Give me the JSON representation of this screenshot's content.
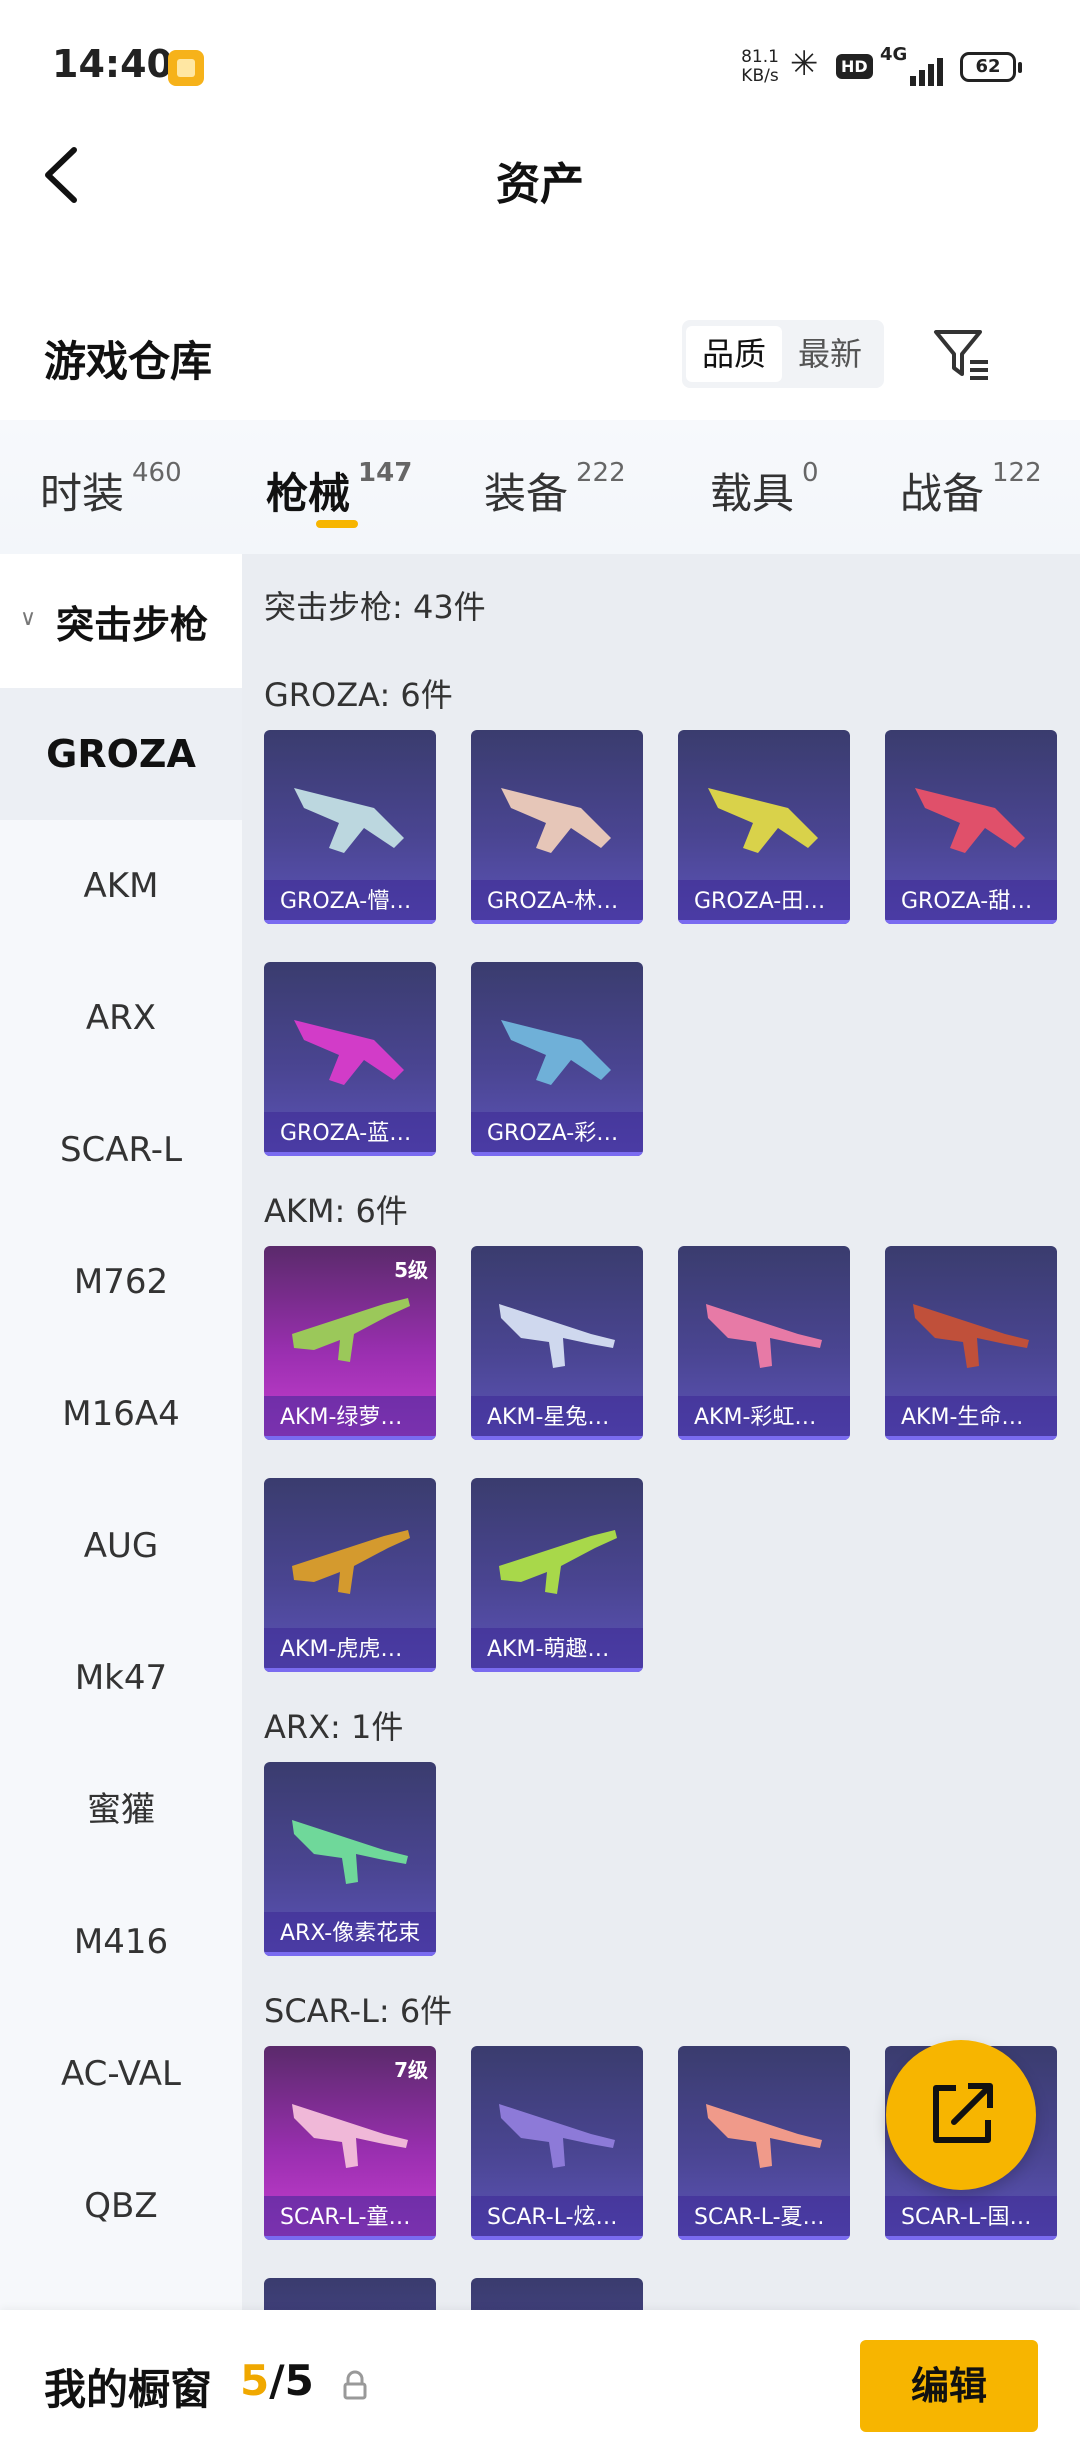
{
  "status_bar": {
    "time": "14:40",
    "net_speed_value": "81.1",
    "net_speed_unit": "KB/s",
    "hd": "HD",
    "network": "4G",
    "battery": "62"
  },
  "header": {
    "title": "资产"
  },
  "warehouse": {
    "title": "游戏仓库",
    "sort_quality": "品质",
    "sort_latest": "最新"
  },
  "tabs": [
    {
      "label": "时装",
      "count": "460"
    },
    {
      "label": "枪械",
      "count": "147"
    },
    {
      "label": "装备",
      "count": "222"
    },
    {
      "label": "载具",
      "count": "0"
    },
    {
      "label": "战备",
      "count": "122"
    }
  ],
  "sidebar": {
    "group": "突击步枪",
    "items": [
      "GROZA",
      "AKM",
      "ARX",
      "SCAR-L",
      "M762",
      "M16A4",
      "AUG",
      "Mk47",
      "蜜獾",
      "M416",
      "AC-VAL",
      "QBZ"
    ]
  },
  "content": {
    "summary": "突击步枪: 43件",
    "sections": [
      {
        "title": "GROZA: 6件",
        "items": [
          "GROZA-懵…",
          "GROZA-林…",
          "GROZA-田…",
          "GROZA-甜…",
          "GROZA-蓝…",
          "GROZA-彩…"
        ]
      },
      {
        "title": "AKM: 6件",
        "items": [
          "AKM-绿萝…",
          "AKM-星兔…",
          "AKM-彩虹…",
          "AKM-生命…",
          "AKM-虎虎…",
          "AKM-萌趣…"
        ],
        "level_badge": "5级"
      },
      {
        "title": "ARX: 1件",
        "items": [
          "ARX-像素花束"
        ]
      },
      {
        "title": "SCAR-L: 6件",
        "items": [
          "SCAR-L-童…",
          "SCAR-L-炫…",
          "SCAR-L-夏…",
          "SCAR-L-国…"
        ],
        "level_badge": "7级"
      }
    ]
  },
  "bottom": {
    "label": "我的橱窗",
    "count_current": "5",
    "count_total": "/5",
    "edit": "编辑"
  },
  "colors": {
    "accent": "#f7b500",
    "card": "#4a4592",
    "card_pink": "#9a2fb0"
  }
}
